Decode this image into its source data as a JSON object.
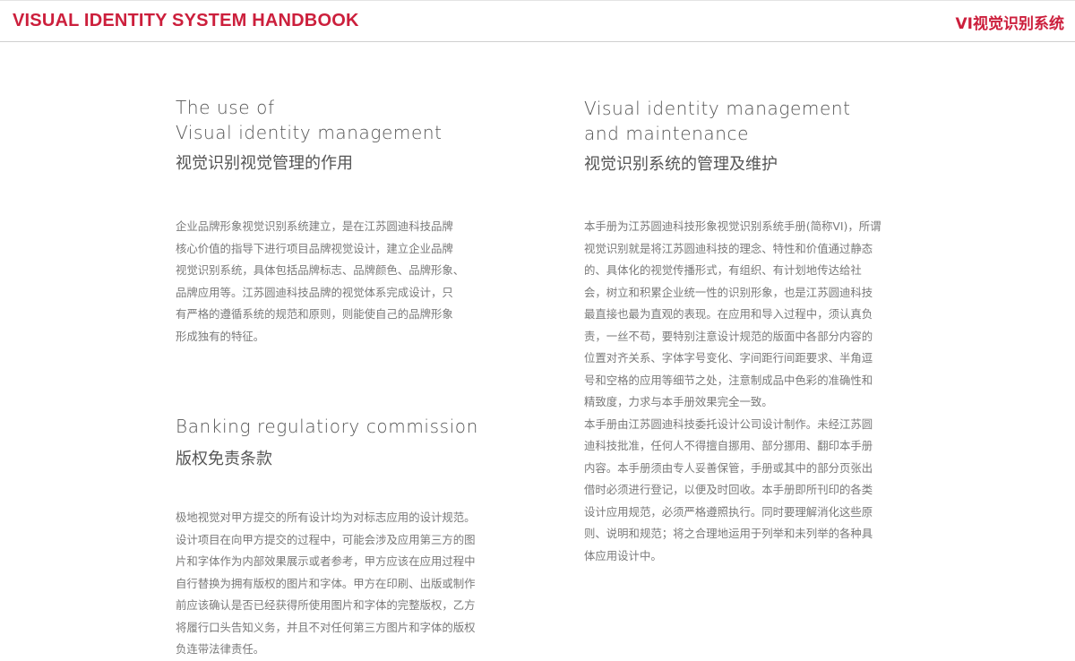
{
  "header": {
    "left_title": "VISUAL IDENTITY SYSTEM HANDBOOK",
    "right_title": "VI视觉识别系统"
  },
  "left_column": {
    "section1": {
      "en_title_line1": "The use of",
      "en_title_line2": "Visual identity management",
      "cn_title": "视觉识别视觉管理的作用",
      "body_lines": [
        "企业品牌形象视觉识别系统建立，是在江苏圆迪科技品牌",
        "核心价值的指导下进行项目品牌视觉设计，建立企业品牌",
        "视觉识别系统，具体包括品牌标志、品牌颜色、品牌形象、",
        "品牌应用等。江苏圆迪科技品牌的视觉体系完成设计，只",
        "有严格的遵循系统的规范和原则，则能使自己的品牌形象",
        "形成独有的特征。"
      ]
    },
    "section2": {
      "en_title_line1": "Banking regulatiory commission",
      "cn_title": "版权免责条款",
      "body_lines": [
        "极地视觉对甲方提交的所有设计均为对标志应用的设计规范。",
        "设计项目在向甲方提交的过程中，可能会涉及应用第三方的图",
        "片和字体作为内部效果展示或者参考，甲方应该在应用过程中",
        "自行替换为拥有版权的图片和字体。甲方在印刷、出版或制作",
        "前应该确认是否已经获得所使用图片和字体的完整版权，乙方",
        "将履行口头告知义务，并且不对任何第三方图片和字体的版权",
        "负连带法律责任。"
      ]
    }
  },
  "right_column": {
    "section1": {
      "en_title_line1": "Visual identity management",
      "en_title_line2": "and maintenance",
      "cn_title": "视觉识别系统的管理及维护",
      "body_lines": [
        "本手册为江苏圆迪科技形象视觉识别系统手册(简称VI)，所谓",
        "视觉识别就是将江苏圆迪科技的理念、特性和价值通过静态",
        "的、具体化的视觉传播形式，有组织、有计划地传达给社",
        "会，树立和积累企业统一性的识别形象，也是江苏圆迪科技",
        "最直接也最为直观的表现。在应用和导入过程中，须认真负",
        "责，一丝不苟，要特别注意设计规范的版面中各部分内容的",
        "位置对齐关系、字体字号变化、字间距行间距要求、半角逗",
        "号和空格的应用等细节之处，注意制成品中色彩的准确性和",
        "精致度，力求与本手册效果完全一致。",
        "本手册由江苏圆迪科技委托设计公司设计制作。未经江苏圆",
        "迪科技批准，任何人不得擅自挪用、部分挪用、翻印本手册",
        "内容。本手册须由专人妥善保管，手册或其中的部分页张出",
        "借时必须进行登记，以便及时回收。本手册即所刊印的各类",
        "设计应用规范，必须严格遵照执行。同时要理解消化这些原",
        "则、说明和规范；将之合理地运用于列举和未列举的各种具",
        "体应用设计中。"
      ]
    }
  },
  "colors": {
    "accent": "#cc1f3c",
    "title": "#555555",
    "body": "#7a7a7a"
  }
}
